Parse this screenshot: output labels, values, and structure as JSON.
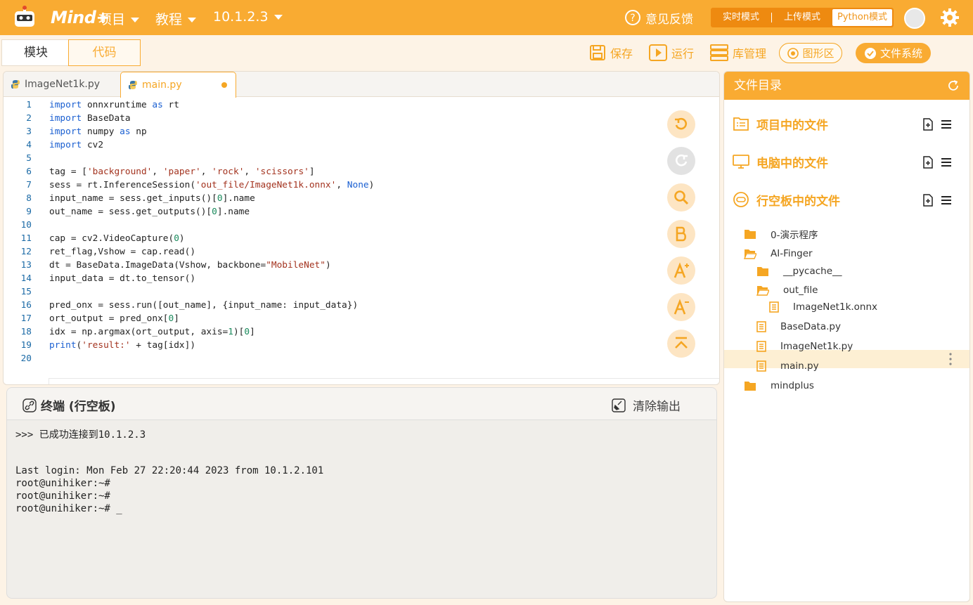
{
  "app": {
    "logo_text": "Mind+"
  },
  "topbar": {
    "menu_project": "项目",
    "menu_tutorial": "教程",
    "menu_device": "10.1.2.3",
    "feedback": "意见反馈",
    "modes": [
      "实时模式",
      "上传模式",
      "Python模式"
    ]
  },
  "subbar": {
    "tab_blocks": "模块",
    "tab_code": "代码",
    "save": "保存",
    "run": "运行",
    "library": "库管理",
    "graphics": "图形区",
    "filesystem": "文件系统"
  },
  "editor": {
    "tabs": [
      {
        "label": "ImageNet1k.py"
      },
      {
        "label": "main.py",
        "modified": true
      }
    ],
    "lines": [
      {
        "n": "1",
        "parts": [
          [
            "kw",
            "import"
          ],
          [
            "t",
            " onnxruntime "
          ],
          [
            "kw",
            "as"
          ],
          [
            "t",
            " rt"
          ]
        ]
      },
      {
        "n": "2",
        "parts": [
          [
            "kw",
            "import"
          ],
          [
            "t",
            " BaseData"
          ]
        ]
      },
      {
        "n": "3",
        "parts": [
          [
            "kw",
            "import"
          ],
          [
            "t",
            " numpy "
          ],
          [
            "kw",
            "as"
          ],
          [
            "t",
            " np"
          ]
        ]
      },
      {
        "n": "4",
        "parts": [
          [
            "kw",
            "import"
          ],
          [
            "t",
            " cv2"
          ]
        ]
      },
      {
        "n": "5",
        "parts": []
      },
      {
        "n": "6",
        "parts": [
          [
            "t",
            "tag = ["
          ],
          [
            "str",
            "'background'"
          ],
          [
            "t",
            ", "
          ],
          [
            "str",
            "'paper'"
          ],
          [
            "t",
            ", "
          ],
          [
            "str",
            "'rock'"
          ],
          [
            "t",
            ", "
          ],
          [
            "str",
            "'scissors'"
          ],
          [
            "t",
            "]"
          ]
        ]
      },
      {
        "n": "7",
        "parts": [
          [
            "t",
            "sess = rt.InferenceSession("
          ],
          [
            "str",
            "'out_file/ImageNet1k.onnx'"
          ],
          [
            "t",
            ", "
          ],
          [
            "kw",
            "None"
          ],
          [
            "t",
            ")"
          ]
        ]
      },
      {
        "n": "8",
        "parts": [
          [
            "t",
            "input_name = sess.get_inputs()["
          ],
          [
            "num",
            "0"
          ],
          [
            "t",
            "].name"
          ]
        ]
      },
      {
        "n": "9",
        "parts": [
          [
            "t",
            "out_name = sess.get_outputs()["
          ],
          [
            "num",
            "0"
          ],
          [
            "t",
            "].name"
          ]
        ]
      },
      {
        "n": "10",
        "parts": []
      },
      {
        "n": "11",
        "parts": [
          [
            "t",
            "cap = cv2.VideoCapture("
          ],
          [
            "num",
            "0"
          ],
          [
            "t",
            ")"
          ]
        ]
      },
      {
        "n": "12",
        "parts": [
          [
            "t",
            "ret_flag,Vshow = cap.read()"
          ]
        ]
      },
      {
        "n": "13",
        "parts": [
          [
            "t",
            "dt = BaseData.ImageData(Vshow, backbone="
          ],
          [
            "str",
            "\"MobileNet\""
          ],
          [
            "t",
            ")"
          ]
        ]
      },
      {
        "n": "14",
        "parts": [
          [
            "t",
            "input_data = dt.to_tensor()"
          ]
        ]
      },
      {
        "n": "15",
        "parts": []
      },
      {
        "n": "16",
        "parts": [
          [
            "t",
            "pred_onx = sess.run([out_name], {input_name: input_data})"
          ]
        ]
      },
      {
        "n": "17",
        "parts": [
          [
            "t",
            "ort_output = pred_onx["
          ],
          [
            "num",
            "0"
          ],
          [
            "t",
            "]"
          ]
        ]
      },
      {
        "n": "18",
        "parts": [
          [
            "t",
            "idx = np.argmax(ort_output, axis="
          ],
          [
            "num",
            "1"
          ],
          [
            "t",
            ")["
          ],
          [
            "num",
            "0"
          ],
          [
            "t",
            "]"
          ]
        ]
      },
      {
        "n": "19",
        "parts": [
          [
            "kw",
            "print"
          ],
          [
            "t",
            "("
          ],
          [
            "str",
            "'result:'"
          ],
          [
            "t",
            " + tag[idx])"
          ]
        ]
      },
      {
        "n": "20",
        "parts": []
      }
    ]
  },
  "terminal": {
    "title": "终端 (行空板)",
    "clear": "清除输出",
    "lines": [
      ">>> 已成功连接到10.1.2.3",
      "",
      "",
      "Last login: Mon Feb 27 22:20:44 2023 from 10.1.2.101",
      "root@unihiker:~#",
      "root@unihiker:~#",
      "root@unihiker:~# _"
    ]
  },
  "files": {
    "title": "文件目录",
    "sections": [
      "项目中的文件",
      "电脑中的文件",
      "行空板中的文件"
    ],
    "tree": [
      {
        "label": "0-演示程序",
        "type": "folder",
        "depth": 0
      },
      {
        "label": "AI-Finger",
        "type": "folder-open",
        "depth": 0
      },
      {
        "label": "__pycache__",
        "type": "folder",
        "depth": 1
      },
      {
        "label": "out_file",
        "type": "folder-open",
        "depth": 1
      },
      {
        "label": "ImageNet1k.onnx",
        "type": "file",
        "depth": 2
      },
      {
        "label": "BaseData.py",
        "type": "file",
        "depth": 1
      },
      {
        "label": "ImageNet1k.py",
        "type": "file",
        "depth": 1
      },
      {
        "label": "main.py",
        "type": "file",
        "depth": 1,
        "selected": true
      },
      {
        "label": "mindplus",
        "type": "folder",
        "depth": 0
      }
    ]
  },
  "colors": {
    "accent": "#f9ab32",
    "accent_dark": "#ee8a10"
  }
}
